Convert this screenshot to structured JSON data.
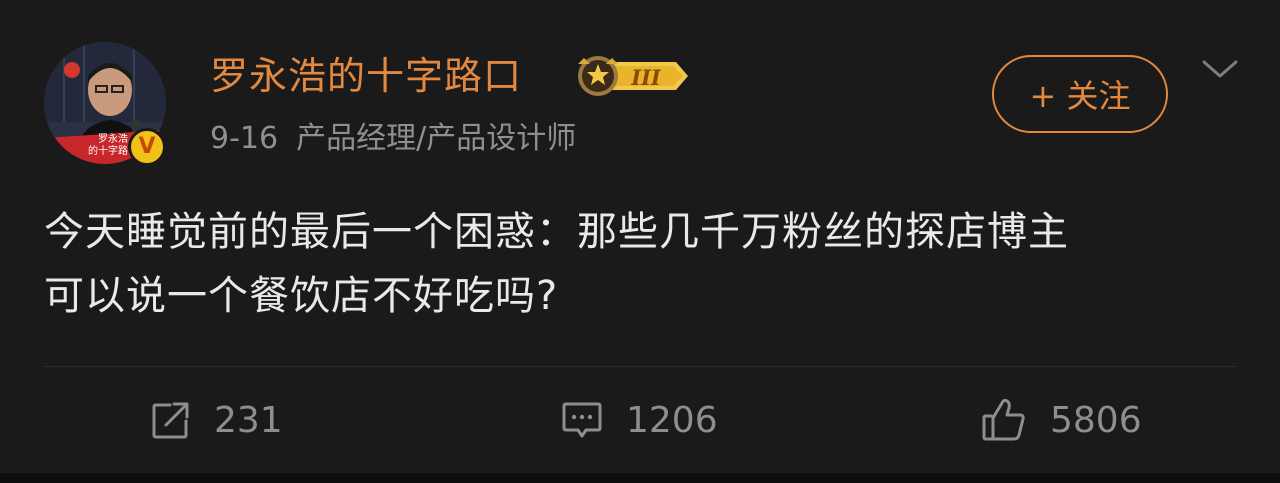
{
  "post": {
    "author": {
      "name": "罗永浩的十字路口",
      "avatar_caption_line1": "罗永浩",
      "avatar_caption_line2": "的十字路口",
      "verified_mark": "V",
      "level": "III"
    },
    "date": "9-16",
    "profession": "产品经理/产品设计师",
    "follow_label": "+ 关注",
    "content_line1": "今天睡觉前的最后一个困惑：那些几千万粉丝的探店博主",
    "content_line2": "可以说一个餐饮店不好吃吗?",
    "stats": {
      "reposts": "231",
      "comments": "1206",
      "likes": "5806"
    }
  },
  "colors": {
    "background": "#1a1a1a",
    "accent": "#e2893f",
    "text": "#e9e9e9",
    "muted": "#8f8f8f",
    "badge_gold": "#f3c218"
  },
  "icons": [
    "chevron-down-icon",
    "repost-icon",
    "comment-icon",
    "like-icon",
    "crown-icon",
    "verified-icon"
  ]
}
